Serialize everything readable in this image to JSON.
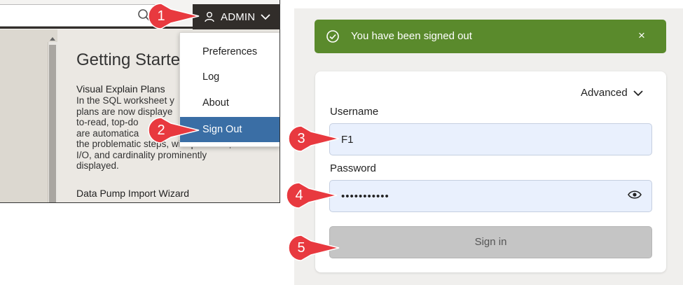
{
  "left": {
    "admin_label": "ADMIN",
    "menu_items": [
      "Preferences",
      "Log",
      "About",
      "Sign Out"
    ],
    "doc": {
      "title": "Getting Starte",
      "h1": "Visual Explain Plans",
      "para": [
        "In the SQL worksheet y",
        "plans are now displaye",
        "to-read, top-do",
        "are automatica",
        "the problematic steps, with plan cost,",
        "I/O, and cardinality prominently",
        "displayed."
      ],
      "h2": "Data Pump Import Wizard"
    }
  },
  "toast": {
    "message": "You have been signed out",
    "close_label": "×",
    "color": "#5a8a2c"
  },
  "login": {
    "advanced_label": "Advanced",
    "username_label": "Username",
    "username_value": "F1",
    "password_label": "Password",
    "password_value": "•••••••••••",
    "signin_label": "Sign in"
  },
  "markers": [
    "1",
    "2",
    "3",
    "4",
    "5"
  ],
  "marker_color": "#e8393f",
  "icons": [
    "search-icon",
    "user-icon",
    "chevron-down-icon",
    "check-circle-icon",
    "close-icon",
    "eye-icon"
  ]
}
